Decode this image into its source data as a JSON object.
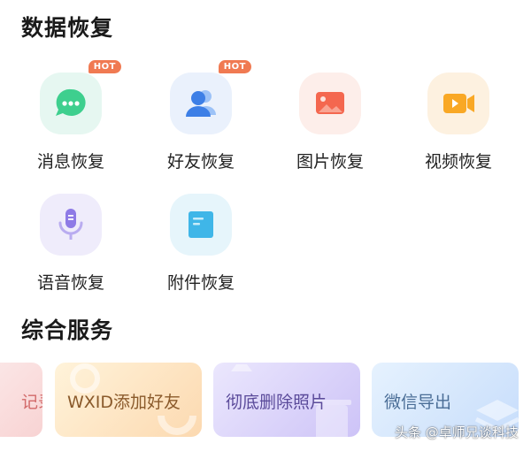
{
  "data_recovery": {
    "title": "数据恢复",
    "hot_badge": "HOT",
    "items": [
      {
        "label": "消息恢复",
        "icon": "chat-bubble-icon",
        "bg": "#e6f7f1",
        "color": "#3ecf8e",
        "hot": true
      },
      {
        "label": "好友恢复",
        "icon": "contacts-icon",
        "bg": "#eaf1fc",
        "color": "#4a8ef0",
        "hot": true
      },
      {
        "label": "图片恢复",
        "icon": "image-icon",
        "bg": "#fdeeea",
        "color": "#f4674f",
        "hot": false
      },
      {
        "label": "视频恢复",
        "icon": "video-camera-icon",
        "bg": "#fdf1e0",
        "color": "#f9a825",
        "hot": false
      },
      {
        "label": "语音恢复",
        "icon": "microphone-icon",
        "bg": "#efecfb",
        "color": "#8e7ae6",
        "hot": false
      },
      {
        "label": "附件恢复",
        "icon": "document-icon",
        "bg": "#e6f5fb",
        "color": "#3fb6e8",
        "hot": false
      }
    ]
  },
  "services": {
    "title": "综合服务",
    "cards": [
      {
        "label": "记录",
        "bg": "#fbe0e0"
      },
      {
        "label": "WXID添加好友",
        "bg": "#fde8c8"
      },
      {
        "label": "彻底删除照片",
        "bg": "#ded8fb"
      },
      {
        "label": "微信导出",
        "bg": "#dcebfd"
      }
    ]
  },
  "watermark": "头条 @卓师兄谈科技"
}
